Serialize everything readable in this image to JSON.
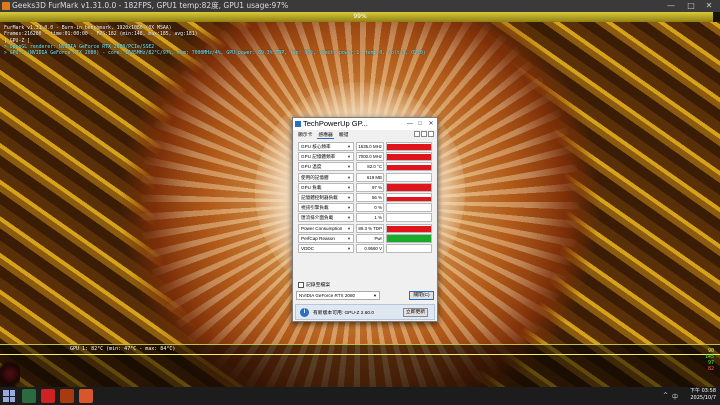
{
  "window": {
    "title": "Geeks3D FurMark v1.31.0.0 - 182FPS, GPU1 temp:82度, GPU1 usage:97%",
    "min": "—",
    "max": "□",
    "close": "✕"
  },
  "progress": {
    "label": "99%",
    "value": 0.99
  },
  "hud": {
    "lines": [
      "FurMark v1.31.0.0 - Burn-in benchmark, 1920x1080 (0X MSAA)",
      "Frames:216200 - time:01:00:00 - FPS:182 (min:148, max:185, avg:181)",
      "[ GPU-Z ]",
      "> OpenGL renderer: NVIDIA GeForce RTX 2080/PCIe/SSE2",
      "> GPU 1 (NVIDIA GeForce RTX 2080) - core: 1635MHz/82°C/97%, mem: 7000MHz/4%, GPU power: 89.3% TDP, fan: 90%, limits(power:1, temp:0, volt:0, OV:0)"
    ]
  },
  "temp_graph": {
    "label": "GPU 1: 82°C (min: 47°C - max: 84°C)",
    "values": [
      "90",
      "145",
      "97",
      "82"
    ]
  },
  "gpuz": {
    "title": "TechPowerUp GP...",
    "tabs": [
      "顯示卡",
      "感應器",
      "驗證"
    ],
    "active_tab": 1,
    "sensors": [
      {
        "name": "GPU 核心頻率",
        "value": "1635.0 MHz",
        "level": 0.85,
        "color": "#e0141a"
      },
      {
        "name": "GPU 記憶體頻率",
        "value": "7000.0 MHz",
        "level": 0.85,
        "color": "#e0141a"
      },
      {
        "name": "GPU 溫度",
        "value": "82.0 °C",
        "level": 0.7,
        "color": "#e0141a"
      },
      {
        "name": "使用的記憶體",
        "value": "619 MB",
        "level": 0.0,
        "color": "#e0141a"
      },
      {
        "name": "GPU 負載",
        "value": "97 %",
        "level": 0.9,
        "color": "#e0141a"
      },
      {
        "name": "記憶體控制器負載",
        "value": "56 %",
        "level": 0.6,
        "color": "#e0141a"
      },
      {
        "name": "視訊引擎負載",
        "value": "0 %",
        "level": 0.0,
        "color": "#e0141a"
      },
      {
        "name": "匯流排介面負載",
        "value": "1 %",
        "level": 0.05,
        "color": "#e0141a"
      },
      {
        "name": "Power Consumption",
        "value": "89.3 % TDP",
        "level": 0.8,
        "color": "#e0141a"
      },
      {
        "name": "PerfCap Reason",
        "value": "Pwr",
        "level": 1.0,
        "color": "#1aaa2a"
      },
      {
        "name": "VDDC",
        "value": "0.9560 V",
        "level": 0.0,
        "color": "#e0141a"
      }
    ],
    "log_label": "記錄至檔案",
    "device": "NVIDIA GeForce RTX 2080",
    "close_label": "關閉(C)",
    "update_text": "有新版本可用: GPU-Z 2.60.0",
    "update_btn": "立即更新"
  },
  "taskbar": {
    "time": "下午 03:58",
    "date": "2025/10/7",
    "tray_lang": "中"
  },
  "colors": {
    "graph_red": "#e0141a",
    "graph_green": "#1aaa2a",
    "accent": "#2a6fbf"
  }
}
